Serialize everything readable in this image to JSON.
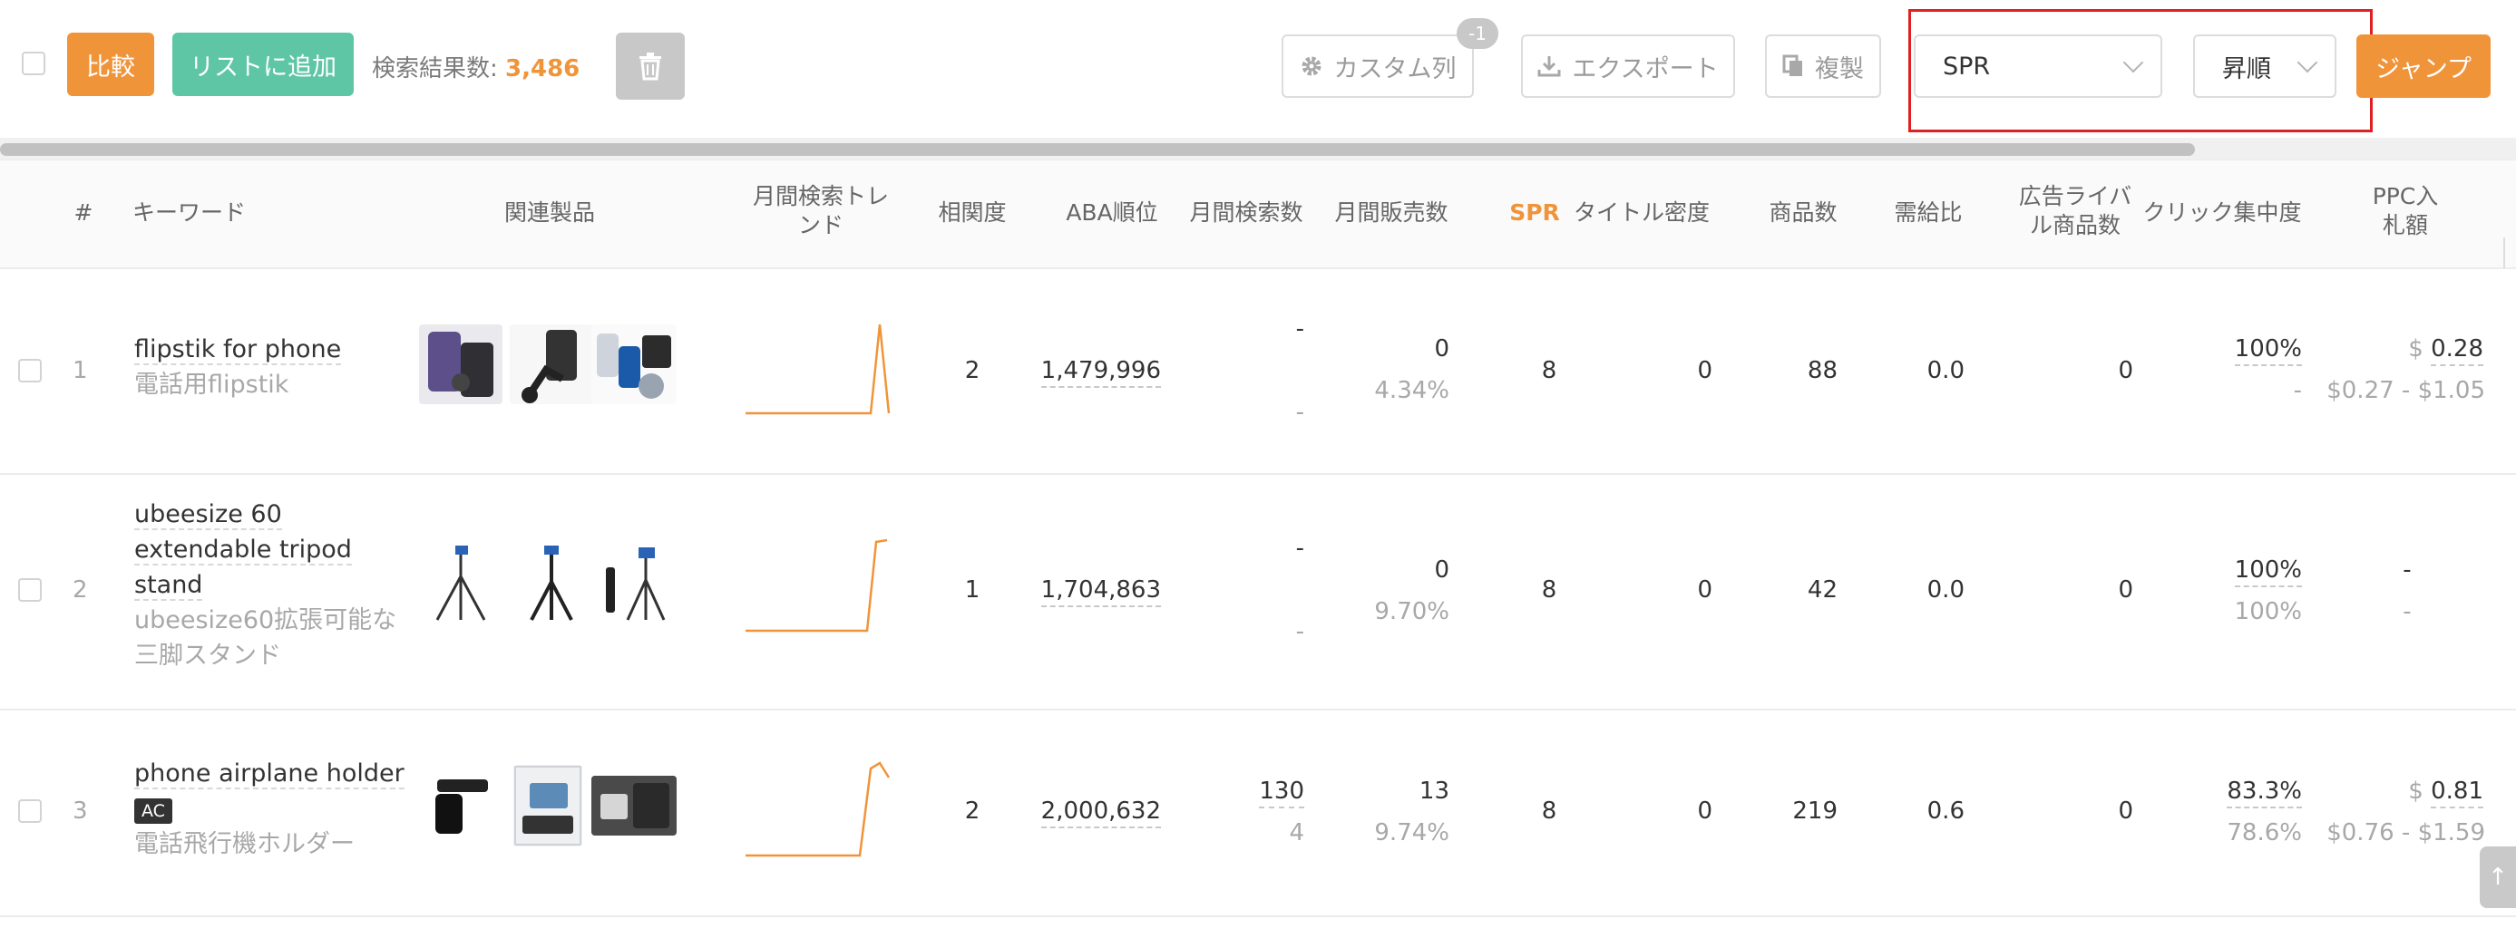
{
  "toolbar": {
    "compare_label": "比較",
    "add_to_list_label": "リストに追加",
    "result_count_label": "検索結果数:",
    "result_count_value": "3,486",
    "custom_columns_label": "カスタム列",
    "custom_columns_badge": "-1",
    "export_label": "エクスポート",
    "copy_label": "複製",
    "sort_field_value": "SPR",
    "sort_order_value": "昇順",
    "jump_label": "ジャンプ"
  },
  "colors": {
    "accent_orange": "#f0943a",
    "accent_green": "#5ec6a4",
    "highlight_red": "#e02020"
  },
  "table": {
    "headers": {
      "index": "#",
      "keyword": "キーワード",
      "related_products": "関連製品",
      "monthly_search_trend": "月間検索トレンド",
      "relevance": "相関度",
      "aba_rank": "ABA順位",
      "monthly_searches": "月間検索数",
      "monthly_sales": "月間販売数",
      "spr": "SPR",
      "title_density": "タイトル密度",
      "product_count": "商品数",
      "supply_demand": "需給比",
      "ad_competitors": "広告ライバル商品数",
      "click_concentration": "クリック集中度",
      "ppc_bid": "PPC入札額"
    },
    "rows": [
      {
        "index": "1",
        "keyword": "flipstik for phone",
        "keyword_ja": "電話用flipstik",
        "tag": "",
        "relevance": "2",
        "aba_rank": "1,479,996",
        "monthly_searches": "-",
        "monthly_searches_sub": "-",
        "monthly_sales": "0",
        "monthly_sales_sub": "4.34%",
        "spr": "8",
        "title_density": "0",
        "product_count": "88",
        "supply_demand": "0.0",
        "ad_competitors": "0",
        "click_concentration": "100%",
        "click_concentration_sub": "-",
        "ppc_currency": "$",
        "ppc_bid": "0.28",
        "ppc_range": "$0.27 - $1.05"
      },
      {
        "index": "2",
        "keyword": "ubeesize 60 extendable tripod stand",
        "keyword_ja": "ubeesize60拡張可能な三脚スタンド",
        "tag": "",
        "relevance": "1",
        "aba_rank": "1,704,863",
        "monthly_searches": "-",
        "monthly_searches_sub": "-",
        "monthly_sales": "0",
        "monthly_sales_sub": "9.70%",
        "spr": "8",
        "title_density": "0",
        "product_count": "42",
        "supply_demand": "0.0",
        "ad_competitors": "0",
        "click_concentration": "100%",
        "click_concentration_sub": "100%",
        "ppc_currency": "",
        "ppc_bid": "-",
        "ppc_range": "-"
      },
      {
        "index": "3",
        "keyword": "phone airplane holder",
        "keyword_ja": "電話飛行機ホルダー",
        "tag": "AC",
        "relevance": "2",
        "aba_rank": "2,000,632",
        "monthly_searches": "130",
        "monthly_searches_sub": "4",
        "monthly_sales": "13",
        "monthly_sales_sub": "9.74%",
        "spr": "8",
        "title_density": "0",
        "product_count": "219",
        "supply_demand": "0.6",
        "ad_competitors": "0",
        "click_concentration": "83.3%",
        "click_concentration_sub": "78.6%",
        "ppc_currency": "$",
        "ppc_bid": "0.81",
        "ppc_range": "$0.76 - $1.59"
      }
    ]
  }
}
